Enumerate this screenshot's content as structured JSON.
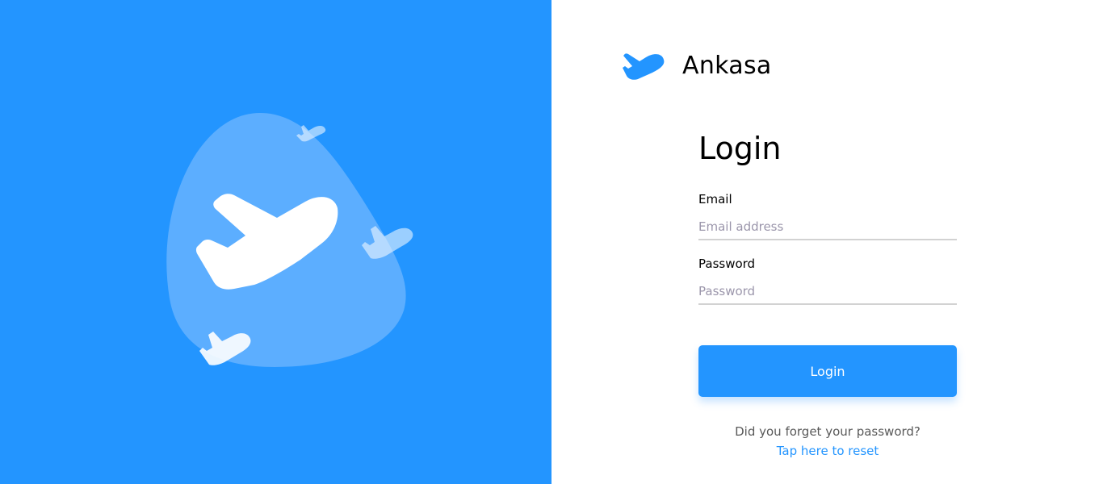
{
  "brand": {
    "name": "Ankasa",
    "logo_icon": "plane-takeoff-icon",
    "color": "#2395FF"
  },
  "hero": {
    "background_color": "#2395FF",
    "blob_color": "#5CAEFF",
    "icons": [
      "plane-takeoff-icon",
      "plane-icon",
      "plane-icon",
      "plane-icon"
    ]
  },
  "login": {
    "title": "Login",
    "email": {
      "label": "Email",
      "placeholder": "Email address",
      "value": ""
    },
    "password": {
      "label": "Password",
      "placeholder": "Password",
      "value": ""
    },
    "submit_label": "Login",
    "forgot_text": "Did you forget your password?",
    "reset_link": "Tap here to reset"
  }
}
